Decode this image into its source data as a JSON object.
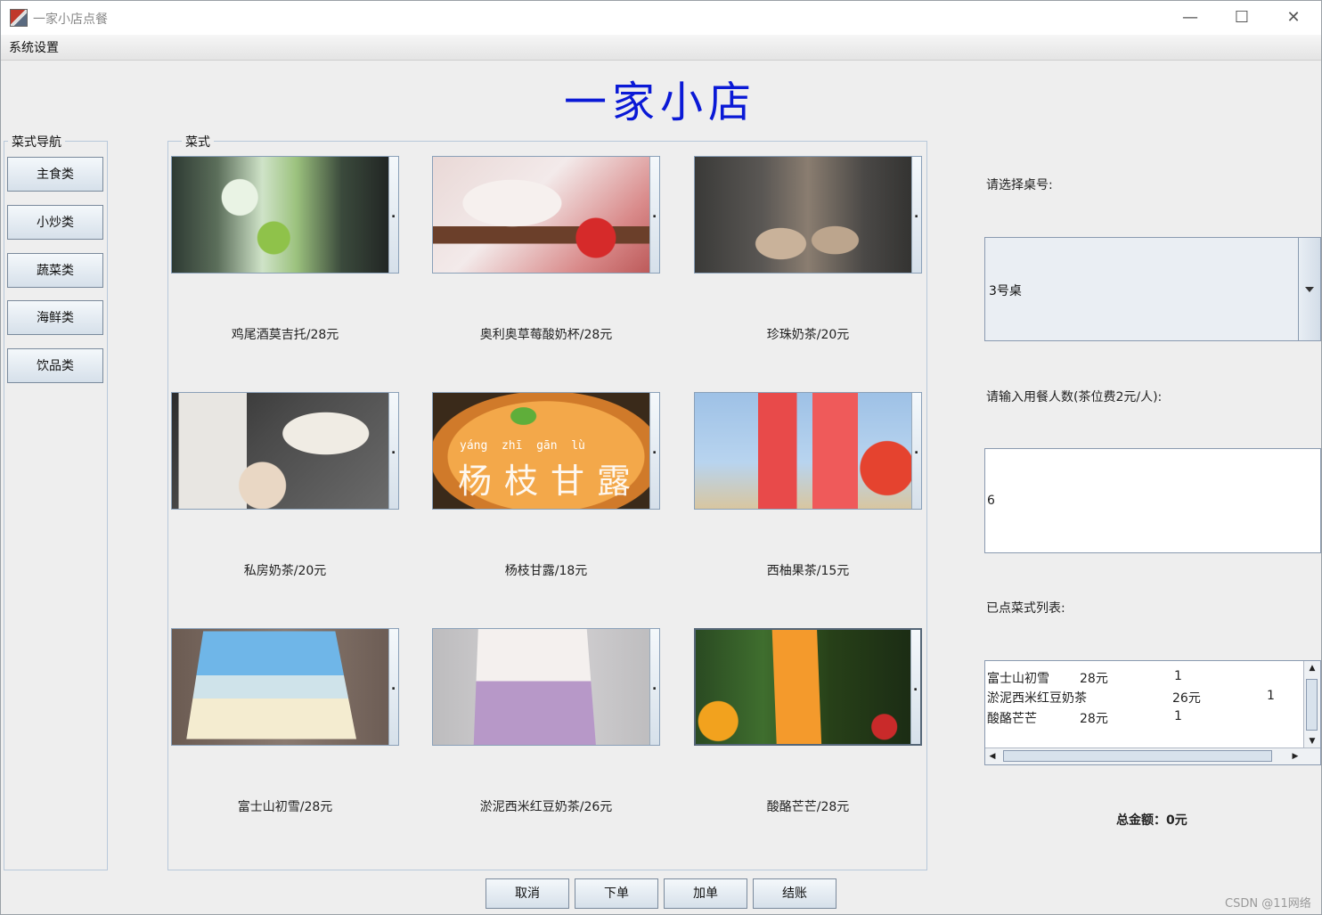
{
  "window": {
    "title": "一家小店点餐"
  },
  "menubar": {
    "system_settings": "系统设置"
  },
  "shop_title": "一家小店",
  "nav": {
    "label": "菜式导航",
    "items": [
      "主食类",
      "小炒类",
      "蔬菜类",
      "海鲜类",
      "饮品类"
    ]
  },
  "dishes": {
    "label": "菜式",
    "items": [
      {
        "name": "鸡尾酒莫吉托/28元"
      },
      {
        "name": "奥利奥草莓酸奶杯/28元"
      },
      {
        "name": "珍珠奶茶/20元"
      },
      {
        "name": "私房奶茶/20元"
      },
      {
        "name": "杨枝甘露/18元",
        "overlay_pinyin": "yáng  zhī  gān  lù",
        "overlay_text": "杨枝甘露"
      },
      {
        "name": "西柚果茶/15元"
      },
      {
        "name": "富士山初雪/28元"
      },
      {
        "name": "淤泥西米红豆奶茶/26元"
      },
      {
        "name": "酸酪芒芒/28元"
      }
    ]
  },
  "order_panel": {
    "table_label": "请选择桌号:",
    "table_value": "3号桌",
    "people_label": "请输入用餐人数(茶位费2元/人):",
    "people_value": "6",
    "list_label": "已点菜式列表:",
    "orders": [
      {
        "name": "富士山初雪",
        "price": "28元",
        "qty": "1"
      },
      {
        "name": "淤泥西米红豆奶茶",
        "price": "26元",
        "qty": "1"
      },
      {
        "name": "酸酪芒芒",
        "price": "28元",
        "qty": "1"
      }
    ],
    "total": "总金额：0元"
  },
  "actions": {
    "cancel": "取消",
    "order": "下单",
    "add": "加单",
    "checkout": "结账"
  },
  "watermark": "CSDN @11网络"
}
